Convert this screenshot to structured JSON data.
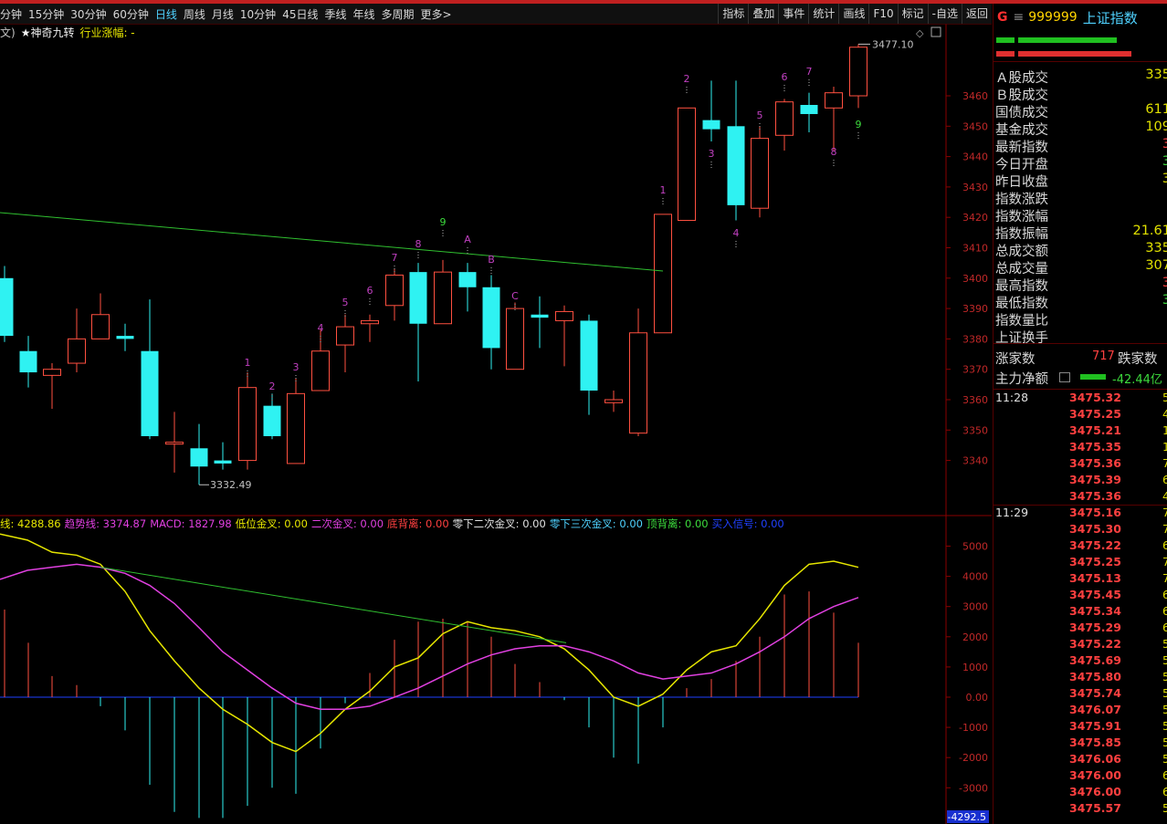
{
  "toolbar": {
    "periods": [
      "分钟",
      "15分钟",
      "30分钟",
      "60分钟",
      "日线",
      "周线",
      "月线",
      "10分钟",
      "45日线",
      "季线",
      "年线",
      "多周期",
      "更多>"
    ],
    "active_period": "日线",
    "tools": [
      "指标",
      "叠加",
      "事件",
      "统计",
      "画线",
      "F10",
      "标记",
      "-自选",
      "返回"
    ]
  },
  "subheader": {
    "prefix": "文)",
    "indicator": "★神奇九转",
    "industry": "行业涨幅: -"
  },
  "price_chart": {
    "high_label": "3477.10",
    "low_label": "3332.49",
    "y_ticks": [
      "3460",
      "3450",
      "3440",
      "3430",
      "3420",
      "3410",
      "3400",
      "3390",
      "3380",
      "3370",
      "3360",
      "3350",
      "3340"
    ],
    "nine_turn_labels": [
      {
        "t": "1",
        "c": "#c040c0"
      },
      {
        "t": "2",
        "c": "#c040c0"
      },
      {
        "t": "3",
        "c": "#c040c0"
      },
      {
        "t": "4",
        "c": "#c040c0"
      },
      {
        "t": "5",
        "c": "#c040c0"
      },
      {
        "t": "6",
        "c": "#c040c0"
      },
      {
        "t": "7",
        "c": "#c040c0"
      },
      {
        "t": "8",
        "c": "#c040c0"
      },
      {
        "t": "9",
        "c": "#3ddc3d"
      },
      {
        "t": "A",
        "c": "#c040c0"
      },
      {
        "t": "B",
        "c": "#c040c0"
      },
      {
        "t": "C",
        "c": "#c040c0"
      },
      {
        "t": "1",
        "c": "#c040c0"
      },
      {
        "t": "2",
        "c": "#c040c0"
      },
      {
        "t": "3",
        "c": "#c040c0"
      },
      {
        "t": "4",
        "c": "#c040c0"
      },
      {
        "t": "5",
        "c": "#c040c0"
      },
      {
        "t": "6",
        "c": "#c040c0"
      },
      {
        "t": "7",
        "c": "#c040c0"
      },
      {
        "t": "8",
        "c": "#c040c0"
      },
      {
        "t": "9",
        "c": "#3ddc3d"
      }
    ]
  },
  "indicator_bar": {
    "items": [
      {
        "label": "线: 4288.86",
        "color": "#e6e600"
      },
      {
        "label": "趋势线: 3374.87",
        "color": "#e040e0"
      },
      {
        "label": "MACD: 1827.98",
        "color": "#e040e0"
      },
      {
        "label": "低位金叉: 0.00",
        "color": "#e6e600"
      },
      {
        "label": "二次金叉: 0.00",
        "color": "#e040e0"
      },
      {
        "label": "底背离: 0.00",
        "color": "#ff4040"
      },
      {
        "label": "零下二次金叉: 0.00",
        "color": "#e0e0e0"
      },
      {
        "label": "零下三次金叉: 0.00",
        "color": "#4fd2ff"
      },
      {
        "label": "顶背离: 0.00",
        "color": "#3ddc3d"
      },
      {
        "label": "买入信号: 0.00",
        "color": "#2040ff"
      }
    ],
    "y_ticks": [
      "5000",
      "4000",
      "3000",
      "2000",
      "1000",
      "0.00",
      "-1000",
      "-2000",
      "-3000"
    ],
    "bottom_value": "-4292.5"
  },
  "right_panel": {
    "g_label": "G",
    "menu_icon": "≡",
    "code": "999999",
    "name": "上证指数",
    "stats": [
      {
        "k": "Ａ股成交",
        "v": "335",
        "cls": ""
      },
      {
        "k": "Ｂ股成交",
        "v": "",
        "cls": ""
      },
      {
        "k": "国债成交",
        "v": "611",
        "cls": ""
      },
      {
        "k": "基金成交",
        "v": "109",
        "cls": ""
      },
      {
        "k": "最新指数",
        "v": "3",
        "cls": "red"
      },
      {
        "k": "今日开盘",
        "v": "3",
        "cls": "green"
      },
      {
        "k": "昨日收盘",
        "v": "3",
        "cls": ""
      },
      {
        "k": "指数涨跌",
        "v": "",
        "cls": ""
      },
      {
        "k": "指数涨幅",
        "v": "",
        "cls": ""
      },
      {
        "k": "指数振幅",
        "v": "21.61",
        "cls": ""
      },
      {
        "k": "总成交额",
        "v": "335",
        "cls": ""
      },
      {
        "k": "总成交量",
        "v": "307",
        "cls": ""
      },
      {
        "k": "最高指数",
        "v": "3",
        "cls": "red"
      },
      {
        "k": "最低指数",
        "v": "3",
        "cls": "green"
      },
      {
        "k": "指数量比",
        "v": "",
        "cls": ""
      },
      {
        "k": "上证换手",
        "v": "",
        "cls": ""
      }
    ],
    "rise_label": "涨家数",
    "rise_value": "717",
    "fall_label": "跌家数",
    "flow_label": "主力净额",
    "flow_value": "-42.44亿",
    "ticks_1128": {
      "time": "11:28",
      "prices": [
        "3475.32",
        "3475.25",
        "3475.21",
        "3475.35",
        "3475.36",
        "3475.39",
        "3475.36"
      ],
      "qty": [
        "5",
        "4",
        "1",
        "1",
        "7",
        "6",
        "4"
      ]
    },
    "ticks_1129": {
      "time": "11:29",
      "prices": [
        "3475.16",
        "3475.30",
        "3475.22",
        "3475.25",
        "3475.13",
        "3475.45",
        "3475.34",
        "3475.29",
        "3475.22",
        "3475.69",
        "3475.80",
        "3475.74",
        "3476.07",
        "3475.91",
        "3475.85",
        "3476.06",
        "3476.00",
        "3476.00",
        "3475.57"
      ],
      "qty": [
        "7",
        "7",
        "6",
        "7",
        "7",
        "6",
        "6",
        "6",
        "5",
        "5",
        "5",
        "5",
        "5",
        "5",
        "5",
        "5",
        "6",
        "6",
        "5"
      ]
    }
  }
}
